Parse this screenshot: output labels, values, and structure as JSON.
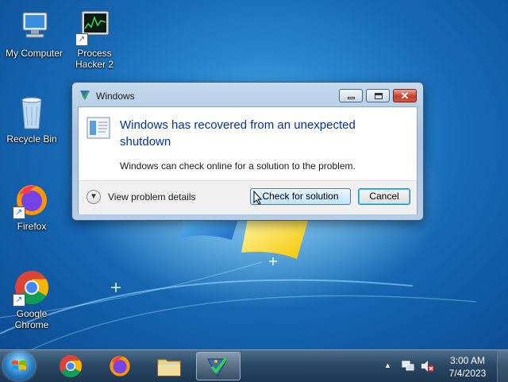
{
  "desktop": {
    "icons": [
      {
        "label": "My Computer",
        "icon": "computer-icon"
      },
      {
        "label": "Process Hacker 2",
        "icon": "process-hacker-icon"
      },
      {
        "label": "Recycle Bin",
        "icon": "recycle-bin-icon"
      },
      {
        "label": "Firefox",
        "icon": "firefox-icon"
      },
      {
        "label": "Google Chrome",
        "icon": "chrome-icon"
      }
    ]
  },
  "dialog": {
    "title": "Windows",
    "main_instruction": "Windows has recovered from an unexpected shutdown",
    "content": "Windows can check online for a solution to the problem.",
    "expand_label": "View problem details",
    "primary_button": "Check for solution",
    "cancel_button": "Cancel",
    "caption_close": "✕"
  },
  "taskbar": {
    "pinned": [
      {
        "name": "chrome",
        "icon": "chrome-icon"
      },
      {
        "name": "firefox",
        "icon": "firefox-icon"
      },
      {
        "name": "file-explorer",
        "icon": "folder-icon"
      },
      {
        "name": "windows-error-reporting",
        "icon": "error-reporting-icon",
        "active": true
      }
    ],
    "tray_arrow": "▲",
    "clock_time": "3:00 AM",
    "clock_date": "7/4/2023"
  },
  "colors": {
    "desktop_blue": "#1668b4",
    "instruction_blue": "#003399",
    "close_red": "#c6402d"
  }
}
